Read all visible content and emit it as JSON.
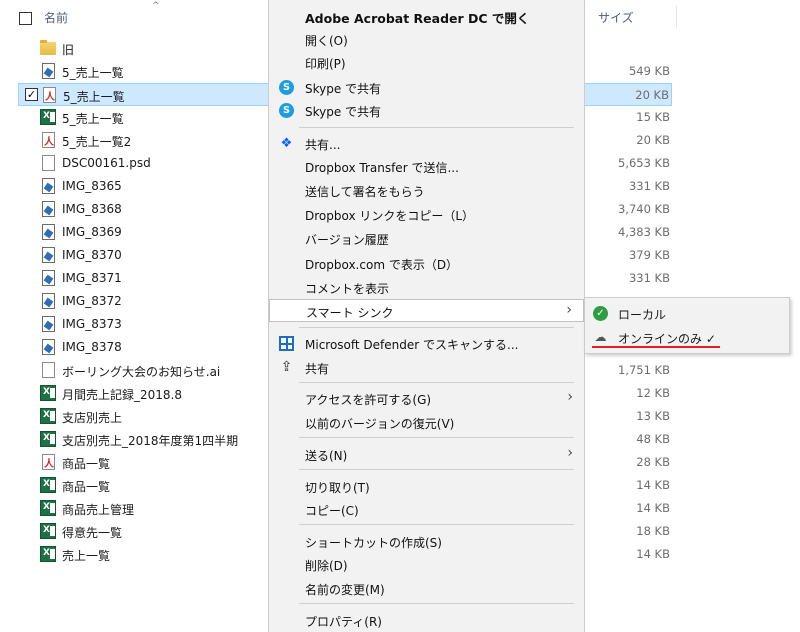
{
  "header": {
    "name_col": "名前",
    "size_col": "サイズ",
    "sort_indicator": "^"
  },
  "files": [
    {
      "name": "旧",
      "size": "",
      "icon": "folder-icon"
    },
    {
      "name": "5_売上一覧",
      "size": "549 KB",
      "icon": "image-file-icon"
    },
    {
      "name": "5_売上一覧",
      "size": "20 KB",
      "icon": "pdf-file-icon",
      "selected": true,
      "checkmark": "✓"
    },
    {
      "name": "5_売上一覧",
      "size": "15 KB",
      "icon": "excel-file-icon"
    },
    {
      "name": "5_売上一覧2",
      "size": "20 KB",
      "icon": "pdf-file-icon"
    },
    {
      "name": "DSC00161.psd",
      "size": "5,653 KB",
      "icon": "document-file-icon"
    },
    {
      "name": "IMG_8365",
      "size": "331 KB",
      "icon": "image-file-icon"
    },
    {
      "name": "IMG_8368",
      "size": "3,740 KB",
      "icon": "image-file-icon"
    },
    {
      "name": "IMG_8369",
      "size": "4,383 KB",
      "icon": "image-file-icon"
    },
    {
      "name": "IMG_8370",
      "size": "379 KB",
      "icon": "image-file-icon"
    },
    {
      "name": "IMG_8371",
      "size": "331 KB",
      "icon": "image-file-icon"
    },
    {
      "name": "IMG_8372",
      "size": "",
      "icon": "image-file-icon"
    },
    {
      "name": "IMG_8373",
      "size": "",
      "icon": "image-file-icon"
    },
    {
      "name": "IMG_8378",
      "size": "",
      "icon": "image-file-icon"
    },
    {
      "name": "ボーリング大会のお知らせ.ai",
      "size": "1,751 KB",
      "icon": "document-file-icon"
    },
    {
      "name": "月間売上記録_2018.8",
      "size": "12 KB",
      "icon": "excel-file-icon"
    },
    {
      "name": "支店別売上",
      "size": "13 KB",
      "icon": "excel-file-icon"
    },
    {
      "name": "支店別売上_2018年度第1四半期",
      "size": "48 KB",
      "icon": "excel-file-icon"
    },
    {
      "name": "商品一覧",
      "size": "28 KB",
      "icon": "pdf-file-icon"
    },
    {
      "name": "商品一覧",
      "size": "14 KB",
      "icon": "excel-file-icon"
    },
    {
      "name": "商品売上管理",
      "size": "14 KB",
      "icon": "excel-file-icon"
    },
    {
      "name": "得意先一覧",
      "size": "18 KB",
      "icon": "excel-file-icon"
    },
    {
      "name": "売上一覧",
      "size": "14 KB",
      "icon": "excel-file-icon"
    }
  ],
  "context_menu": {
    "open_acrobat": "Adobe Acrobat Reader DC で開く",
    "open": "開く(O)",
    "print": "印刷(P)",
    "skype_share_1": "Skype で共有",
    "skype_share_2": "Skype で共有",
    "share_dropbox": "共有...",
    "dropbox_transfer": "Dropbox Transfer で送信...",
    "send_sign": "送信して署名をもらう",
    "copy_dropbox_link": "Dropbox リンクをコピー（L）",
    "version_history": "バージョン履歴",
    "view_dropbox_com": "Dropbox.com で表示（D）",
    "show_comments": "コメントを表示",
    "smart_sync": "スマート シンク",
    "defender_scan": "Microsoft Defender でスキャンする...",
    "share": "共有",
    "give_access": "アクセスを許可する(G)",
    "restore_versions": "以前のバージョンの復元(V)",
    "send_to": "送る(N)",
    "cut": "切り取り(T)",
    "copy": "コピー(C)",
    "create_shortcut": "ショートカットの作成(S)",
    "delete": "削除(D)",
    "rename": "名前の変更(M)",
    "properties": "プロパティ(R)",
    "submenu_arrow": "›"
  },
  "smart_sync_submenu": {
    "local": "ローカル",
    "online_only": "オンラインのみ ✓",
    "highlight_color": "#e02020"
  }
}
